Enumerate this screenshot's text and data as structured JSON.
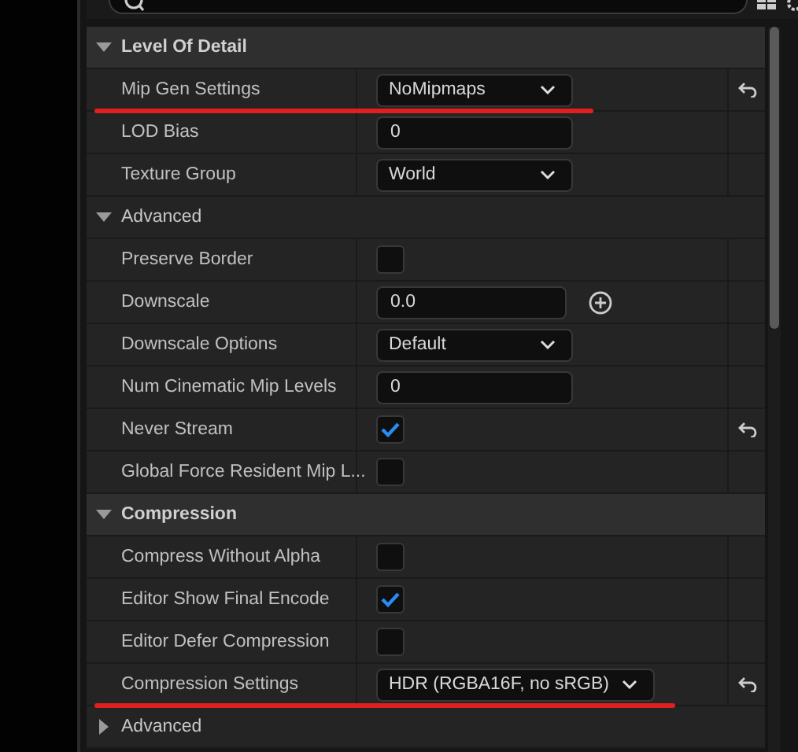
{
  "sections": [
    {
      "title": "Level Of Detail",
      "expanded": true,
      "rows": [
        {
          "kind": "dropdown",
          "label": "Mip Gen Settings",
          "value": "NoMipmaps",
          "reset": true,
          "annotated": true
        },
        {
          "kind": "number",
          "label": "LOD Bias",
          "value": "0",
          "reset": false,
          "annotated": false
        },
        {
          "kind": "dropdown",
          "label": "Texture Group",
          "value": "World",
          "reset": false,
          "annotated": false
        },
        {
          "kind": "group",
          "label": "Advanced",
          "expanded": true,
          "children": [
            {
              "kind": "checkbox",
              "label": "Preserve Border",
              "checked": false,
              "reset": false,
              "annotated": false
            },
            {
              "kind": "number-add",
              "label": "Downscale",
              "value": "0.0",
              "reset": false,
              "annotated": false
            },
            {
              "kind": "dropdown",
              "label": "Downscale Options",
              "value": "Default",
              "reset": false,
              "annotated": false
            },
            {
              "kind": "number",
              "label": "Num Cinematic Mip Levels",
              "value": "0",
              "reset": false,
              "annotated": false
            },
            {
              "kind": "checkbox",
              "label": "Never Stream",
              "checked": true,
              "reset": true,
              "annotated": false
            },
            {
              "kind": "checkbox",
              "label": "Global Force Resident Mip L...",
              "checked": false,
              "reset": false,
              "annotated": false
            }
          ]
        }
      ]
    },
    {
      "title": "Compression",
      "expanded": true,
      "rows": [
        {
          "kind": "checkbox",
          "label": "Compress Without Alpha",
          "checked": false,
          "reset": false,
          "annotated": false
        },
        {
          "kind": "checkbox",
          "label": "Editor Show Final Encode",
          "checked": true,
          "reset": false,
          "annotated": false
        },
        {
          "kind": "checkbox",
          "label": "Editor Defer Compression",
          "checked": false,
          "reset": false,
          "annotated": false
        },
        {
          "kind": "dropdown",
          "label": "Compression Settings",
          "value": "HDR (RGBA16F, no sRGB)",
          "reset": true,
          "annotated": true
        },
        {
          "kind": "group",
          "label": "Advanced",
          "expanded": false,
          "children": []
        }
      ]
    }
  ]
}
